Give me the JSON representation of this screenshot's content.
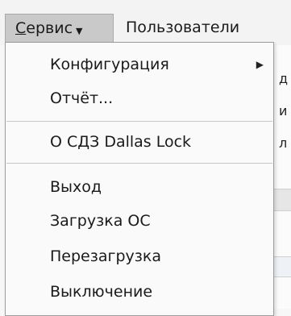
{
  "menubar": {
    "service_pre": "",
    "service_mnemonic": "С",
    "service_rest": "ервис",
    "service_caret_icon": "caret-down-icon",
    "users": "Пользователи"
  },
  "dropdown": {
    "items": [
      {
        "label": "Конфигурация",
        "submenu_icon": "triangle-right-icon"
      },
      {
        "label": "Отчёт..."
      },
      {
        "label": "О СДЗ Dallas Lock"
      },
      {
        "label": "Выход"
      },
      {
        "label": "Загрузка ОС"
      },
      {
        "label": "Перезагрузка"
      },
      {
        "label": "Выключение"
      }
    ]
  },
  "background": {
    "chars": [
      "д",
      "и",
      "л"
    ]
  },
  "colors": {
    "menubar_active_bg": "#c9c9c9",
    "dropdown_bg": "#fafafa",
    "separator": "#c8c8c8"
  }
}
